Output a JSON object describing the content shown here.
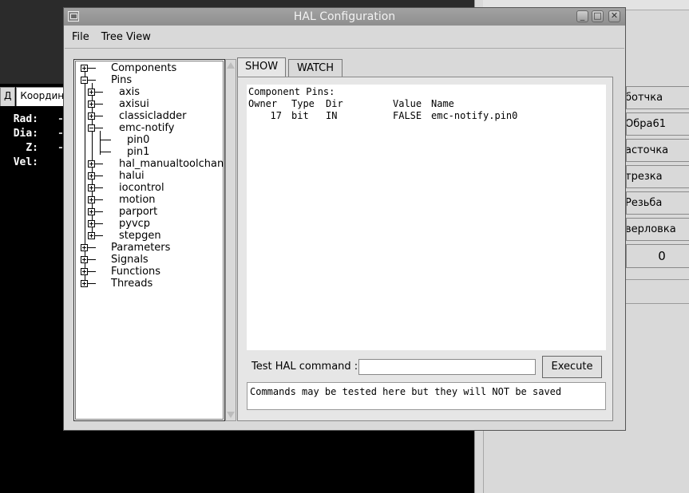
{
  "background": {
    "tabs": [
      "Д",
      "Координ"
    ],
    "dro": [
      {
        "label": "Rad:",
        "value": "-"
      },
      {
        "label": "Dia:",
        "value": "-"
      },
      {
        "label": "Z:",
        "value": "-"
      },
      {
        "label": "Vel:",
        "value": ""
      }
    ],
    "right_buttons": [
      "ботчка",
      "Обра61",
      "асточка",
      "трезка",
      "Резьба",
      "верловка"
    ],
    "right_counter": "0"
  },
  "window": {
    "title": "HAL Configuration",
    "icon": "window-menu-icon"
  },
  "menu": [
    "File",
    "Tree View"
  ],
  "tree": {
    "components": "Components",
    "pins": "Pins",
    "pin_children": [
      "axis",
      "axisui",
      "classicladder",
      "emc-notify",
      "hal_manualtoolchange",
      "halui",
      "iocontrol",
      "motion",
      "parport",
      "pyvcp",
      "stepgen"
    ],
    "emc_notify_children": [
      "pin0",
      "pin1"
    ],
    "parameters": "Parameters",
    "signals": "Signals",
    "functions": "Functions",
    "threads": "Threads"
  },
  "tabs": {
    "show": "SHOW",
    "watch": "WATCH"
  },
  "pins_view": {
    "heading": "Component Pins:",
    "columns": [
      "Owner",
      "Type",
      "Dir",
      "Value",
      "Name"
    ],
    "rows": [
      {
        "owner": "17",
        "type": "bit",
        "dir": "IN",
        "value": "FALSE",
        "name": "emc-notify.pin0"
      }
    ]
  },
  "command": {
    "label": "Test HAL command :",
    "value": "",
    "execute": "Execute",
    "output": "Commands may be tested here but they will NOT be saved"
  }
}
